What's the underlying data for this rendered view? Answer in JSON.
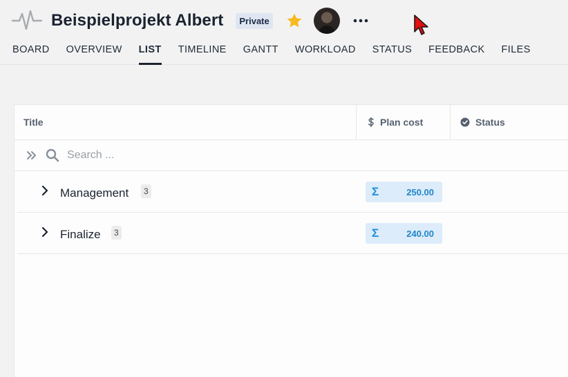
{
  "header": {
    "project_title": "Beispielprojekt Albert",
    "visibility_badge": "Private",
    "icons": [
      "activity-icon",
      "star-icon",
      "avatar",
      "more-icon"
    ],
    "accent_color": "#f6b91f"
  },
  "tabs": [
    {
      "label": "BOARD",
      "active": false
    },
    {
      "label": "OVERVIEW",
      "active": false
    },
    {
      "label": "LIST",
      "active": true
    },
    {
      "label": "TIMELINE",
      "active": false
    },
    {
      "label": "GANTT",
      "active": false
    },
    {
      "label": "WORKLOAD",
      "active": false
    },
    {
      "label": "STATUS",
      "active": false
    },
    {
      "label": "FEEDBACK",
      "active": false
    },
    {
      "label": "FILES",
      "active": false
    }
  ],
  "table": {
    "columns": [
      {
        "label": "Title",
        "icon": ""
      },
      {
        "label": "Plan cost",
        "icon": "dollar-icon"
      },
      {
        "label": "Status",
        "icon": "check-circle-icon"
      }
    ],
    "search": {
      "placeholder": "Search ...",
      "value": ""
    },
    "groups": [
      {
        "name": "Management",
        "count": "3",
        "plan_cost": "250.00",
        "sum_symbol": "Σ"
      },
      {
        "name": "Finalize",
        "count": "3",
        "plan_cost": "240.00",
        "sum_symbol": "Σ"
      }
    ]
  }
}
